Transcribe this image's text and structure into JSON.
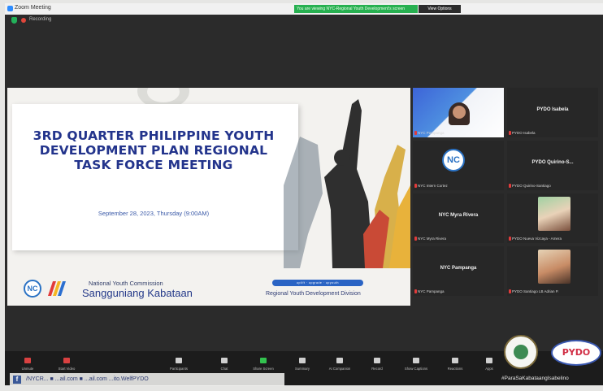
{
  "window": {
    "app_title": "Zoom Meeting",
    "share_banner": "You are viewing NYC-Regional Youth Development's screen",
    "view_options": "View Options"
  },
  "meeting": {
    "recording_label": "Recording"
  },
  "slide": {
    "headline": "3RD QUARTER PHILIPPINE YOUTH DEVELOPMENT PLAN REGIONAL TASK FORCE MEETING",
    "date": "September 28, 2023, Thursday (9:00AM)",
    "org_line1": "National Youth Commission",
    "org_line2": "Sangguniang Kabataan",
    "nc_badge": "NC",
    "tags": "uplift · upgrade · upyouth",
    "division": "Regional Youth Development Division"
  },
  "participants": [
    {
      "name": "NYC Pampanga"
    },
    {
      "name": "PYDO Isabela",
      "display": "PYDO Isabela"
    },
    {
      "name": "NYC Intern Cortez",
      "badge": "NC"
    },
    {
      "name": "PYDO Quirino-Santiago",
      "display": "PYDO Quirino-S..."
    },
    {
      "name": "NYC Myra Rivera",
      "display": "NYC Myra Rivera"
    },
    {
      "name": "PYDO Nueva Vizcaya - Amera"
    },
    {
      "name": "NYC Pampanga",
      "display": "NYC Pampanga"
    },
    {
      "name": "PYDO Santiago LB Adrian P."
    }
  ],
  "toolbar": {
    "unmute": "Unmute",
    "start_video": "Start Video",
    "participants": "Participants",
    "chat": "Chat",
    "share_screen": "Share Screen",
    "summary": "Summary",
    "ai_companion": "AI Companion",
    "record": "Record",
    "show_captions": "Show Captions",
    "reactions": "Reactions",
    "apps": "Apps"
  },
  "overlay": {
    "social_text": "/NYCR... ■ ...ail.com ■ ...ail.com  ...ito.WelfPYDO",
    "hashtag": "#ParaSaKabataangIsabelino",
    "pydo_logo_text": "PYDO"
  },
  "colors": {
    "headline": "#23348c",
    "active_speaker": "#e2d13b",
    "share_banner": "#27b050"
  }
}
